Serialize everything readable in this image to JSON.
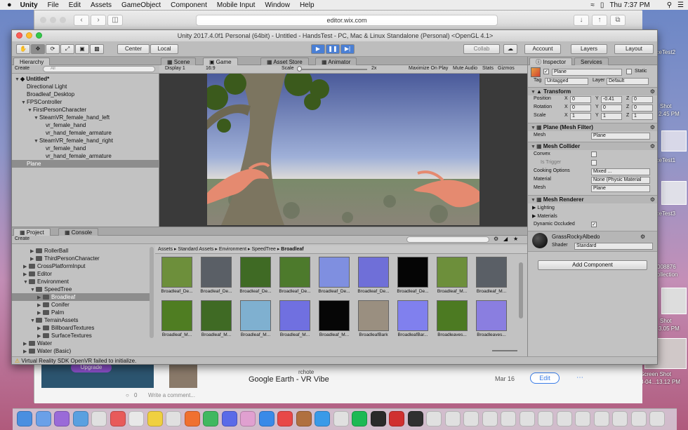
{
  "menubar": {
    "apple": "",
    "app": "Unity",
    "items": [
      "File",
      "Edit",
      "Assets",
      "GameObject",
      "Component",
      "Mobile Input",
      "Window",
      "Help"
    ],
    "clock": "Thu 7:37 PM"
  },
  "desktop": {
    "items": [
      "aceTest2",
      "Shot",
      "2.45 PM",
      "aceTest1",
      "aceTest3",
      "008876",
      "ollection",
      "Shot",
      "3.05 PM",
      "Screen Shot",
      "8-04...13.12 PM"
    ]
  },
  "safari": {
    "url": "editor.wix.com",
    "behind": {
      "upgrade": "Upgrade",
      "post_title": "Google Earth - VR Vibe",
      "post_date": "Mar 16",
      "edit": "Edit",
      "comments_count": "0",
      "comment_placeholder": "Write a comment...",
      "author": "rchote"
    }
  },
  "unity": {
    "title": "Unity 2017.4.0f1 Personal (64bit) - Untitled - HandsTest - PC, Mac & Linux Standalone (Personal) <OpenGL 4.1>",
    "toolbar": {
      "center": "Center",
      "local": "Local",
      "collab": "Collab",
      "account": "Account",
      "layers": "Layers",
      "layout": "Layout"
    },
    "hierarchy": {
      "tab": "Hierarchy",
      "create": "Create",
      "search_placeholder": "All",
      "scene": "Untitled*",
      "items": [
        {
          "label": "Directional Light",
          "indent": 1
        },
        {
          "label": "Broadleaf_Desktop",
          "indent": 1
        },
        {
          "label": "FPSController",
          "indent": 1
        },
        {
          "label": "FirstPersonCharacter",
          "indent": 2
        },
        {
          "label": "SteamVR_female_hand_left",
          "indent": 3
        },
        {
          "label": "vr_female_hand",
          "indent": 4
        },
        {
          "label": "vr_hand_female_armature",
          "indent": 4
        },
        {
          "label": "SteamVR_female_hand_right",
          "indent": 3
        },
        {
          "label": "vr_female_hand",
          "indent": 4
        },
        {
          "label": "vr_hand_female_armature",
          "indent": 4
        },
        {
          "label": "Plane",
          "indent": 1
        }
      ]
    },
    "view_tabs": {
      "scene": "Scene",
      "game": "Game",
      "asset_store": "Asset Store",
      "animator": "Animator",
      "display": "Display 1",
      "aspect": "16:9",
      "scale_label": "Scale",
      "scale_value": "2x",
      "maximize": "Maximize On Play",
      "mute": "Mute Audio",
      "stats": "Stats",
      "gizmos": "Gizmos"
    },
    "inspector": {
      "tab": "Inspector",
      "services": "Services",
      "object_name": "Plane",
      "static": "Static",
      "tag_label": "Tag",
      "tag_value": "Untagged",
      "layer_label": "Layer",
      "layer_value": "Default",
      "transform": {
        "title": "Transform",
        "position": {
          "label": "Position",
          "x": "0",
          "y": "-0.41",
          "z": "0"
        },
        "rotation": {
          "label": "Rotation",
          "x": "0",
          "y": "0",
          "z": "0"
        },
        "scale": {
          "label": "Scale",
          "x": "1",
          "y": "1",
          "z": "1"
        }
      },
      "mesh_filter": {
        "title": "Plane (Mesh Filter)",
        "mesh_label": "Mesh",
        "mesh_value": "Plane"
      },
      "mesh_collider": {
        "title": "Mesh Collider",
        "convex": "Convex",
        "is_trigger": "Is Trigger",
        "cooking_label": "Cooking Options",
        "cooking_value": "Mixed ...",
        "material_label": "Material",
        "material_value": "None (Physic Material",
        "mesh_label": "Mesh",
        "mesh_value": "Plane"
      },
      "mesh_renderer": {
        "title": "Mesh Renderer",
        "lighting": "Lighting",
        "materials": "Materials",
        "dynamic_occluded": "Dynamic Occluded"
      },
      "material": {
        "name": "GrassRockyAlbedo",
        "shader_label": "Shader",
        "shader_value": "Standard"
      },
      "add_component": "Add Component"
    },
    "project": {
      "tab": "Project",
      "console": "Console",
      "create": "Create",
      "tree": [
        {
          "label": "RollerBall",
          "indent": 2
        },
        {
          "label": "ThirdPersonCharacter",
          "indent": 2
        },
        {
          "label": "CrossPlatformInput",
          "indent": 1
        },
        {
          "label": "Editor",
          "indent": 1
        },
        {
          "label": "Environment",
          "indent": 1
        },
        {
          "label": "SpeedTree",
          "indent": 2
        },
        {
          "label": "Broadleaf",
          "indent": 3
        },
        {
          "label": "Conifer",
          "indent": 3
        },
        {
          "label": "Palm",
          "indent": 3
        },
        {
          "label": "TerrainAssets",
          "indent": 2
        },
        {
          "label": "BillboardTextures",
          "indent": 3
        },
        {
          "label": "SurfaceTextures",
          "indent": 3
        },
        {
          "label": "Water",
          "indent": 1
        },
        {
          "label": "Water (Basic)",
          "indent": 1
        }
      ],
      "breadcrumb": [
        "Assets",
        "Standard Assets",
        "Environment",
        "SpeedTree",
        "Broadleaf"
      ],
      "assets": [
        {
          "label": "Broadleaf_De...",
          "color": "#6d8f3b"
        },
        {
          "label": "Broadleaf_De...",
          "color": "#5a5f66"
        },
        {
          "label": "Broadleaf_De...",
          "color": "#3f6a24"
        },
        {
          "label": "Broadleaf_De...",
          "color": "#4d7a2c"
        },
        {
          "label": "Broadleaf_De...",
          "color": "#7f8fe0"
        },
        {
          "label": "Broadleaf_De...",
          "color": "#6f6fd8"
        },
        {
          "label": "Broadleaf_De...",
          "color": "#050505"
        },
        {
          "label": "Broadleaf_M...",
          "color": "#6d8f3b"
        },
        {
          "label": "Broadleaf_M...",
          "color": "#5a5f66"
        },
        {
          "label": "Broadleaf_M...",
          "color": "#4f7d22"
        },
        {
          "label": "Broadleaf_M...",
          "color": "#3f6a24"
        },
        {
          "label": "Broadleaf_M...",
          "color": "#7fb0d0"
        },
        {
          "label": "Broadleaf_M...",
          "color": "#7070e0"
        },
        {
          "label": "Broadleaf_M...",
          "color": "#060606"
        },
        {
          "label": "BroadleafBark",
          "color": "#9a8f80"
        },
        {
          "label": "BroadleafBar...",
          "color": "#8080ee"
        },
        {
          "label": "Broadleaves...",
          "color": "#4c7a22"
        },
        {
          "label": "Broadleaves...",
          "color": "#8a7ee0"
        }
      ]
    },
    "status": "Virtual Reality SDK OpenVR failed to initialize."
  }
}
